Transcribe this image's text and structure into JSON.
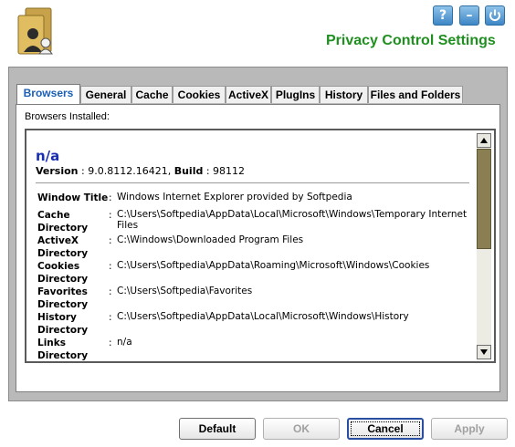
{
  "header": {
    "title": "Privacy Control Settings",
    "help_label": "?",
    "minimize_label": "–",
    "power_icon": "power-icon",
    "logo_icon": "folder-user-icon"
  },
  "tabs": [
    {
      "label": "Browsers",
      "active": true
    },
    {
      "label": "General"
    },
    {
      "label": "Cache"
    },
    {
      "label": "Cookies"
    },
    {
      "label": "ActiveX"
    },
    {
      "label": "PlugIns"
    },
    {
      "label": "History"
    },
    {
      "label": "Files and Folders"
    }
  ],
  "browsers": {
    "installed_label": "Browsers Installed:",
    "name": "n/a",
    "version_key": "Version",
    "version_value": "9.0.8112.16421",
    "build_key": "Build",
    "build_value": "98112",
    "properties": [
      {
        "key": "Window Title",
        "value": "Windows Internet Explorer provided by Softpedia"
      },
      {
        "key": "Cache Directory",
        "value": "C:\\Users\\Softpedia\\AppData\\Local\\Microsoft\\Windows\\Temporary Internet Files"
      },
      {
        "key": "ActiveX Directory",
        "value": "C:\\Windows\\Downloaded Program Files"
      },
      {
        "key": "Cookies Directory",
        "value": "C:\\Users\\Softpedia\\AppData\\Roaming\\Microsoft\\Windows\\Cookies"
      },
      {
        "key": "Favorites Directory",
        "value": "C:\\Users\\Softpedia\\Favorites"
      },
      {
        "key": "History Directory",
        "value": "C:\\Users\\Softpedia\\AppData\\Local\\Microsoft\\Windows\\History"
      },
      {
        "key": "Links Directory",
        "value": "n/a"
      }
    ]
  },
  "buttons": {
    "default": "Default",
    "ok": "OK",
    "cancel": "Cancel",
    "apply": "Apply"
  },
  "colors": {
    "title": "#1f8f1f",
    "active_tab": "#1a5fb4",
    "browser_name": "#1a2fb0",
    "scroll_thumb": "#8a7f52"
  }
}
